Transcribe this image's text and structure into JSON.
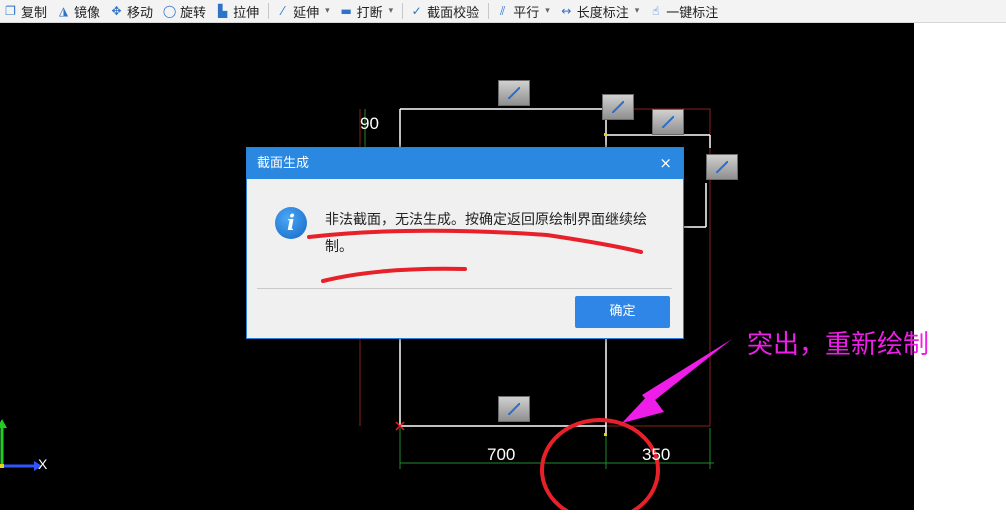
{
  "toolbar": {
    "items": [
      {
        "label": "复制",
        "icon": "copy-icon"
      },
      {
        "label": "镜像",
        "icon": "mirror-icon"
      },
      {
        "label": "移动",
        "icon": "move-icon"
      },
      {
        "label": "旋转",
        "icon": "rotate-icon"
      },
      {
        "label": "拉伸",
        "icon": "stretch-icon"
      },
      {
        "label": "延伸",
        "icon": "extend-icon"
      },
      {
        "label": "打断",
        "icon": "break-icon"
      },
      {
        "label": "截面校验",
        "icon": "section-check-icon"
      },
      {
        "label": "平行",
        "icon": "parallel-icon"
      },
      {
        "label": "长度标注",
        "icon": "length-dimension-icon"
      },
      {
        "label": "一键标注",
        "icon": "one-click-dimension-icon"
      }
    ]
  },
  "canvas": {
    "background": "#000000",
    "dimensions": {
      "top_left": "90",
      "bottom_left": "700",
      "bottom_right": "350"
    },
    "axis_x_label": "X"
  },
  "dialog": {
    "title": "截面生成",
    "close_symbol": "×",
    "message": "非法截面，无法生成。按确定返回原绘制界面继续绘制。",
    "ok_label": "确定",
    "title_color": "#2a88e0",
    "button_color": "#2f86e6"
  },
  "annotation": {
    "text": "突出，重新绘制",
    "color": "#ee1ee8",
    "underline_color": "#e8202a",
    "circle_color": "#e8202a"
  }
}
